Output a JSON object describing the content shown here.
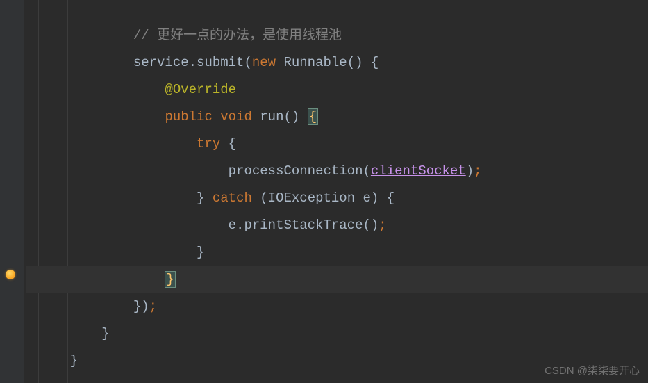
{
  "code": {
    "comment_line": "// 更好一点的办法，是使用线程池",
    "service_submit_prefix": "service.submit(",
    "new_kw": "new",
    "runnable_class": " Runnable() {",
    "override_annotation": "@Override",
    "public_kw": "public",
    "void_kw": " void",
    "run_method": " run() ",
    "open_brace_highlighted": "{",
    "try_kw": "try",
    "try_brace": " {",
    "process_call_prefix": "processConnection(",
    "client_socket": "clientSocket",
    "process_call_suffix": ")",
    "semi": ";",
    "close_brace_plain": "}",
    "catch_kw": " catch",
    "catch_params": " (IOException e) {",
    "print_stack": "e.printStackTrace()",
    "close_brace_highlighted": "}",
    "anon_close": "})",
    "final_close1": "}",
    "final_close2": "}"
  },
  "watermark": "CSDN @柒柒要开心",
  "indent": "    "
}
